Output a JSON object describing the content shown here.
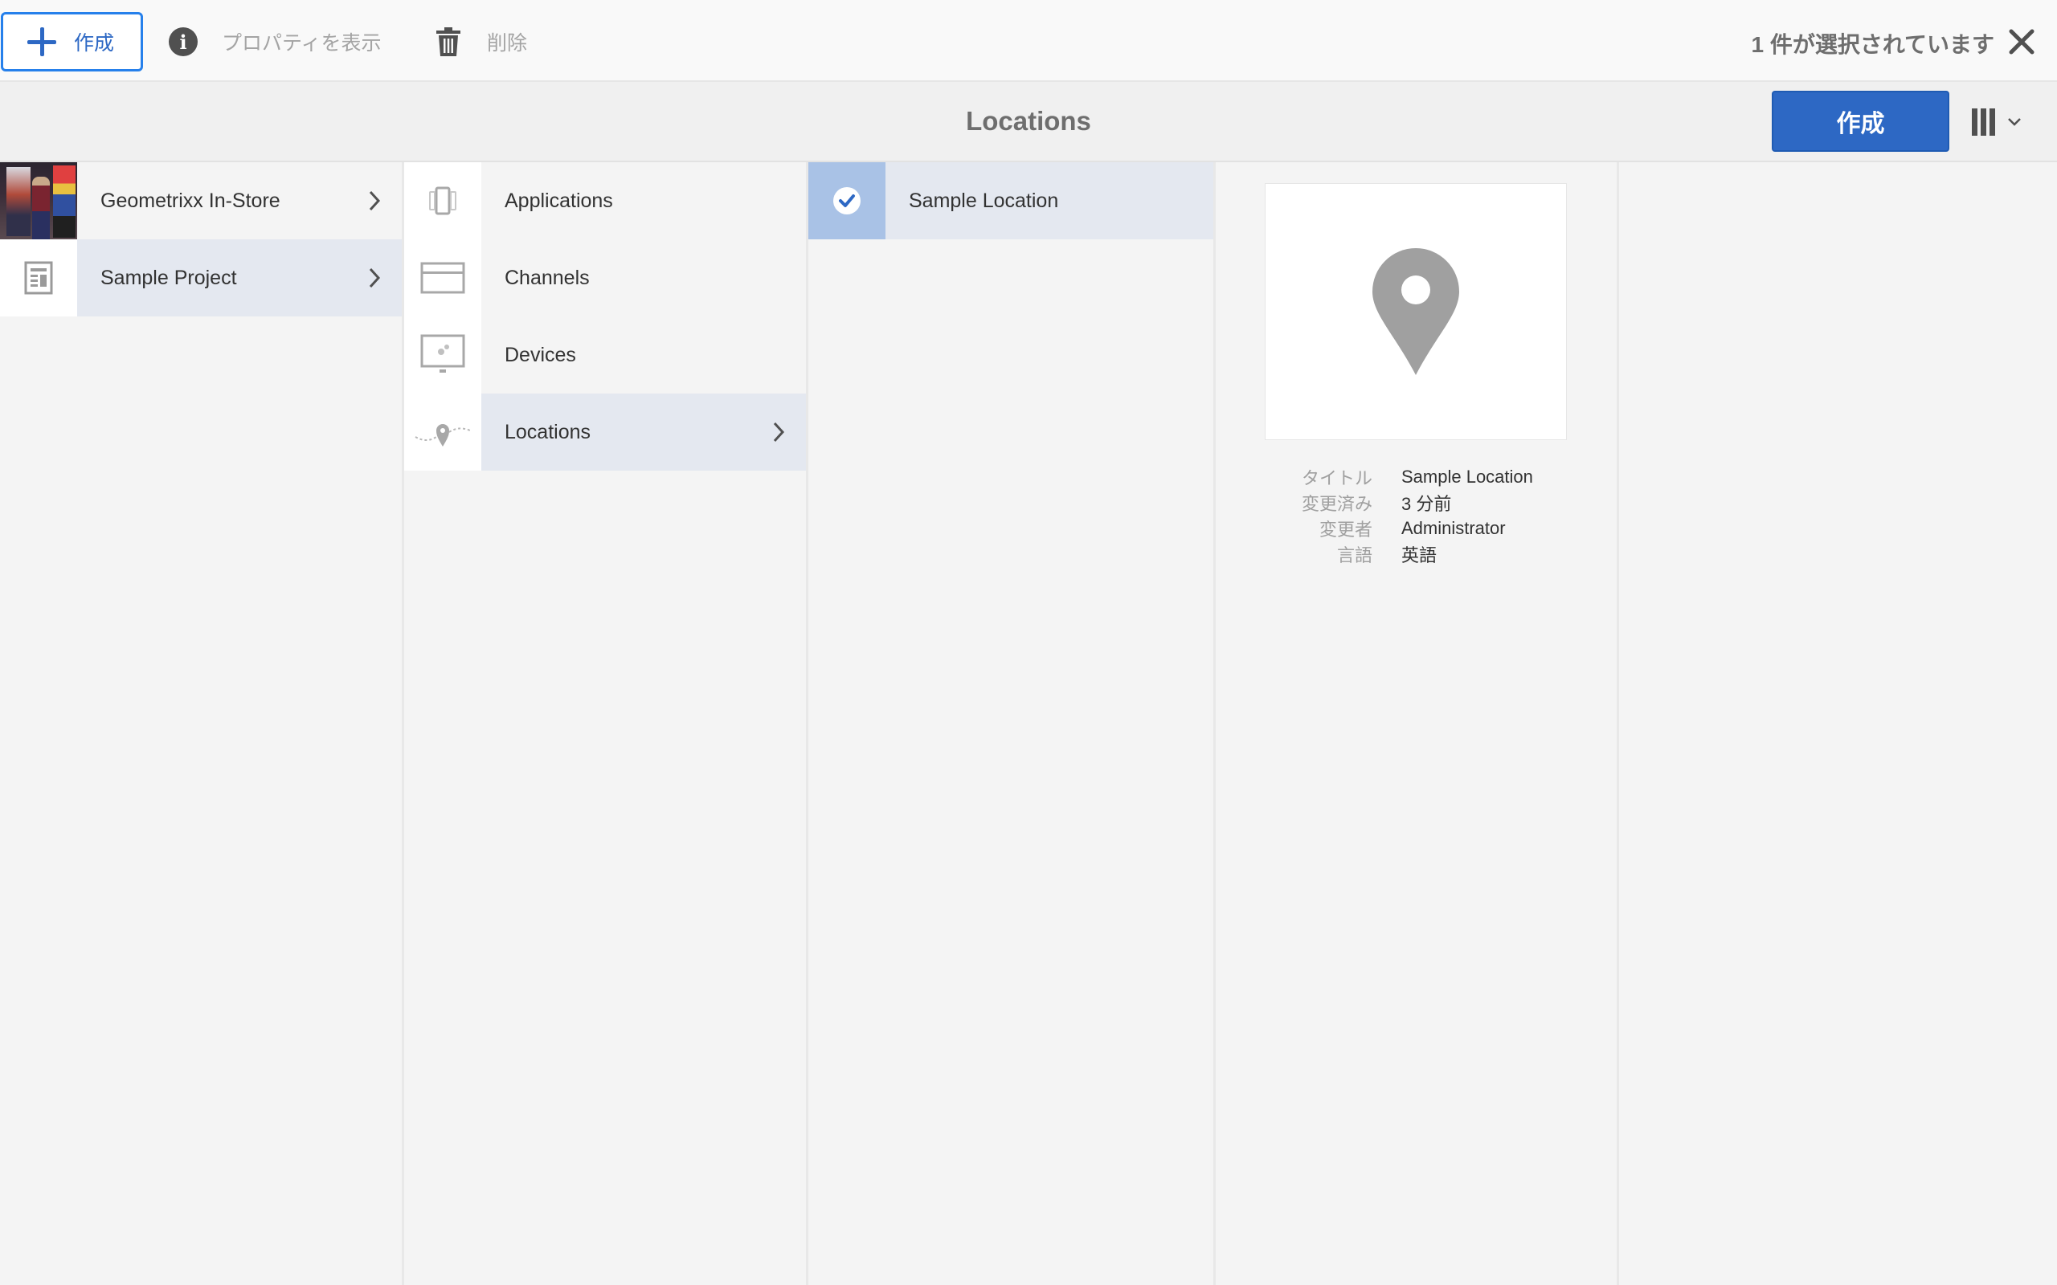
{
  "actionbar": {
    "create_label": "作成",
    "properties_label": "プロパティを表示",
    "delete_label": "削除",
    "selection_count": "1 件が選択されています"
  },
  "titlebar": {
    "title": "Locations",
    "create_label": "作成"
  },
  "columns": {
    "col1": [
      {
        "label": "Geometrixx In-Store",
        "icon": "photo-thumbnail"
      },
      {
        "label": "Sample Project",
        "icon": "project-icon"
      }
    ],
    "col2": [
      {
        "label": "Applications",
        "icon": "applications-icon"
      },
      {
        "label": "Channels",
        "icon": "channels-icon"
      },
      {
        "label": "Devices",
        "icon": "devices-icon"
      },
      {
        "label": "Locations",
        "icon": "location-icon"
      }
    ],
    "col3": [
      {
        "label": "Sample Location",
        "icon": "check-icon"
      }
    ]
  },
  "preview": {
    "icon": "map-pin-icon",
    "fields": [
      {
        "key": "タイトル",
        "value": "Sample Location"
      },
      {
        "key": "変更済み",
        "value": "3 分前"
      },
      {
        "key": "変更者",
        "value": "Administrator"
      },
      {
        "key": "言語",
        "value": "英語"
      }
    ]
  },
  "colors": {
    "accent": "#2d68c4",
    "selected_thumb": "#a9c2e6",
    "active_row": "#e4e8f0"
  }
}
